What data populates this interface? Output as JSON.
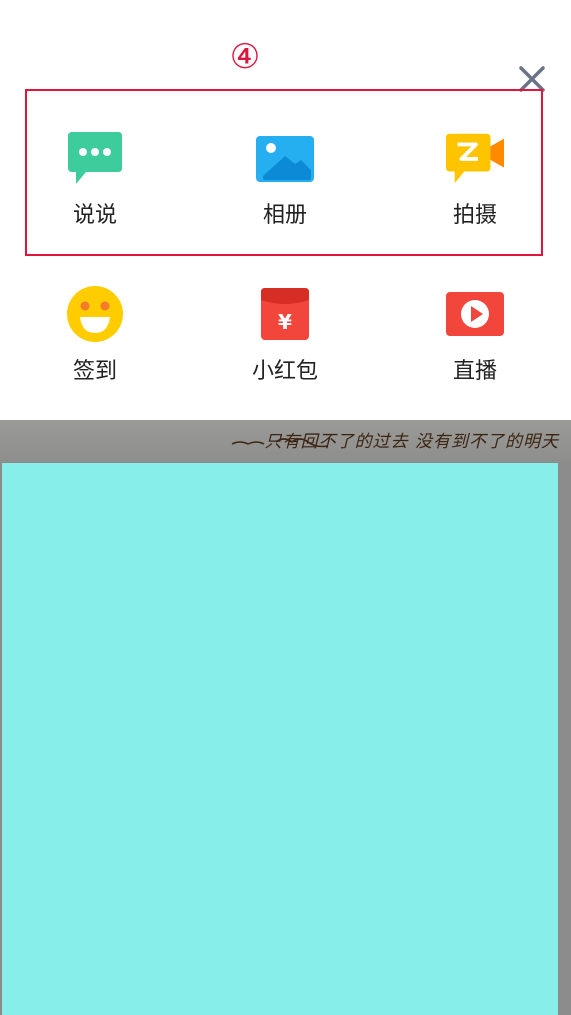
{
  "annotation": {
    "number": "④",
    "color": "#e0143c"
  },
  "close": {
    "icon": "close-icon",
    "color": "#6b7386"
  },
  "menu": {
    "items": [
      {
        "label": "说说",
        "icon": "speech-bubble-icon",
        "color": "#3dcc9c"
      },
      {
        "label": "相册",
        "icon": "photo-album-icon",
        "color": "#25aef0"
      },
      {
        "label": "拍摄",
        "icon": "video-camera-icon",
        "color": "#ffc400"
      },
      {
        "label": "签到",
        "icon": "smiley-face-icon",
        "color": "#ffcc00"
      },
      {
        "label": "小红包",
        "icon": "red-envelope-icon",
        "color": "#f2463c"
      },
      {
        "label": "直播",
        "icon": "live-play-icon",
        "color": "#f2463c"
      }
    ]
  },
  "banner": {
    "text": "只有回不了的过去 没有到不了的明天"
  },
  "colors": {
    "panel": "#88eeea",
    "overlay": "#8c8c8c"
  }
}
